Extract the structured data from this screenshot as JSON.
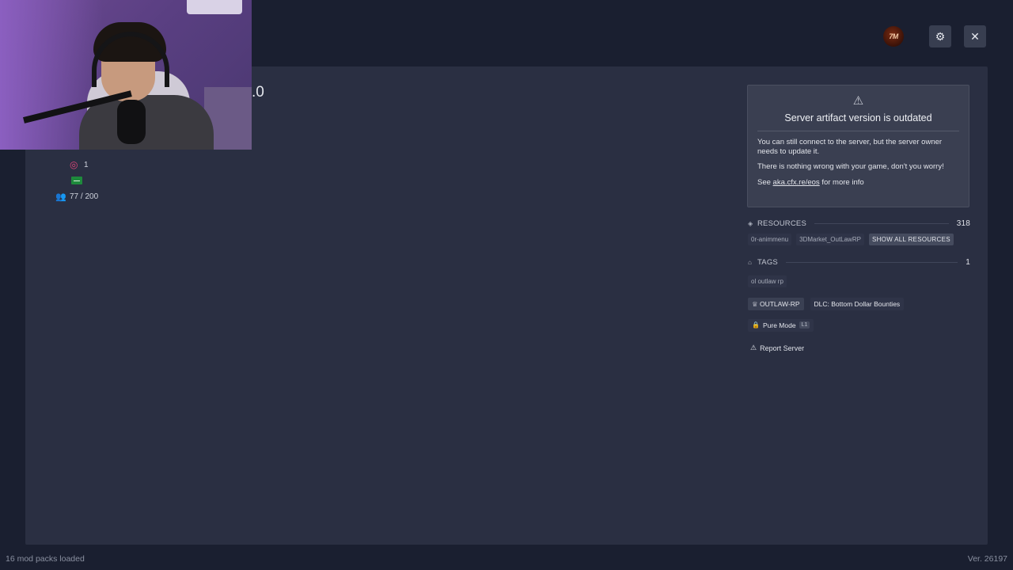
{
  "topbar": {
    "avatar_text": "7M",
    "settings_icon": "gear-icon",
    "close_icon": "close-icon",
    "close_glyph": "✕",
    "settings_glyph": "⚙"
  },
  "server": {
    "title_fragment": ".0",
    "boosts": "1",
    "players": "77 / 200"
  },
  "warning": {
    "icon": "warning-icon",
    "title": "Server artifact version is outdated",
    "line1": "You can still connect to the server, but the server owner needs to update it.",
    "line2": "There is nothing wrong with your game, don't you worry!",
    "line3_prefix": "See ",
    "line3_link": "aka.cfx.re/eos",
    "line3_suffix": " for more info"
  },
  "resources": {
    "label": "RESOURCES",
    "count": "318",
    "items": [
      "0r-animmenu",
      "3DMarket_OutLawRP"
    ],
    "show_all_label": "SHOW ALL RESOURCES"
  },
  "tags": {
    "label": "TAGS",
    "count": "1",
    "items": [
      "ol outlaw rp"
    ]
  },
  "badges": {
    "project": "OUTLAW-RP",
    "dlc": "DLC: Bottom Dollar Bounties",
    "pure_mode": "Pure Mode",
    "pure_key": "L1"
  },
  "report_label": "Report Server",
  "footer": {
    "mods_loaded": "16 mod packs loaded",
    "version": "Ver. 26197"
  },
  "colors": {
    "background": "#1a1f30",
    "panel": "#2a2f42",
    "boost_accent": "#e0457a",
    "flag_green": "#1e8a3c"
  }
}
